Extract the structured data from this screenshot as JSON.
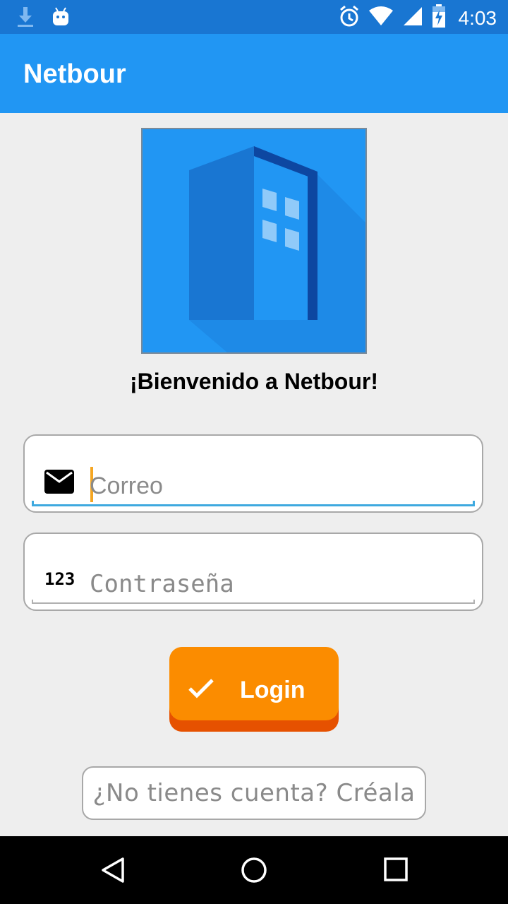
{
  "status_bar": {
    "time": "4:03",
    "left_icons": [
      "download-icon",
      "android-icon"
    ],
    "right_icons": [
      "alarm-icon",
      "wifi-icon",
      "signal-icon",
      "battery-charging-icon"
    ]
  },
  "app_bar": {
    "title": "Netbour"
  },
  "logo": {
    "icon": "building-icon",
    "background_color": "#2196F3"
  },
  "welcome_text": "¡Bienvenido a Netbour!",
  "email_field": {
    "icon": "mail-icon",
    "placeholder": "Correo",
    "value": ""
  },
  "password_field": {
    "icon": "123",
    "placeholder": "Contraseña",
    "value": ""
  },
  "login_button": {
    "icon": "check-icon",
    "label": "Login",
    "color": "#FB8C00"
  },
  "signup_link": {
    "label": "¿No tienes cuenta? Créala"
  },
  "nav_bar": {
    "buttons": [
      "back-icon",
      "home-icon",
      "recents-icon"
    ]
  },
  "colors": {
    "primary_dark": "#1976D2",
    "primary": "#2196F3",
    "accent": "#FB8C00",
    "focus_underline": "#3EA9DF"
  }
}
